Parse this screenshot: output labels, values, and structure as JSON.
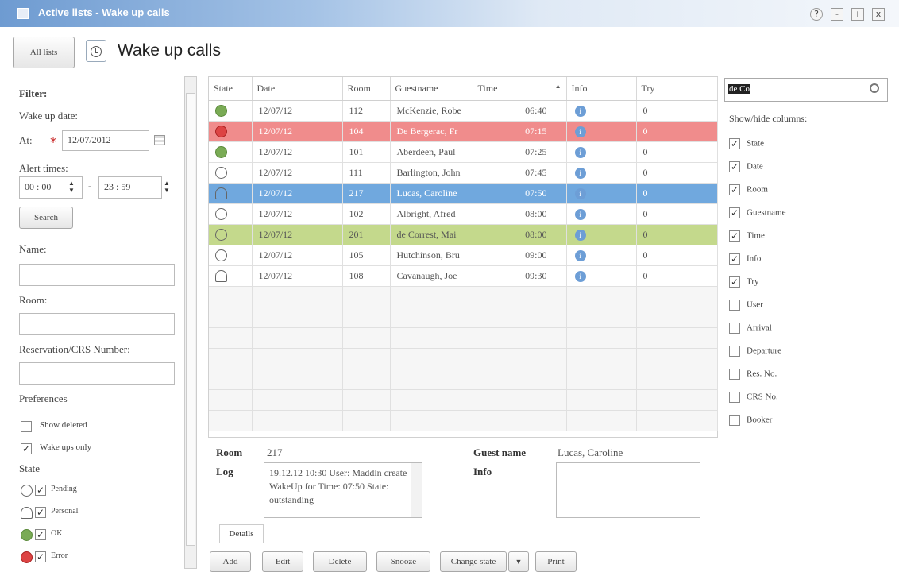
{
  "window": {
    "title": "Active lists - Wake up calls",
    "help": "?",
    "minimize": "-",
    "maximize": "+",
    "close": "x"
  },
  "header": {
    "all_lists": "All lists",
    "page_title": "Wake up calls"
  },
  "filter": {
    "title": "Filter:",
    "wake_up_date": "Wake up date:",
    "at": "At:",
    "date_value": "12/07/2012",
    "alert_times": "Alert times:",
    "from_time": "00 : 00",
    "dash": "-",
    "to_time": "23 : 59",
    "search": "Search",
    "name": "Name:",
    "room": "Room:",
    "reservation": "Reservation/CRS Number:",
    "preferences": "Preferences",
    "show_deleted": "Show deleted",
    "wake_ups_only": "Wake ups only",
    "state": "State",
    "states": [
      "Pending",
      "Personal",
      "OK",
      "Error"
    ]
  },
  "grid": {
    "columns": [
      "State",
      "Date",
      "Room",
      "Guestname",
      "Time",
      "Info",
      "Try"
    ],
    "sort_indicator": "▲",
    "rows": [
      {
        "state": "ok",
        "date": "12/07/12",
        "room": "112",
        "guest": "McKenzie, Robe",
        "time": "06:40",
        "try": "0",
        "style": ""
      },
      {
        "state": "err",
        "date": "12/07/12",
        "room": "104",
        "guest": "De Bergerac, Fr",
        "time": "07:15",
        "try": "0",
        "style": "row-red"
      },
      {
        "state": "ok",
        "date": "12/07/12",
        "room": "101",
        "guest": "Aberdeen, Paul",
        "time": "07:25",
        "try": "0",
        "style": ""
      },
      {
        "state": "pending",
        "date": "12/07/12",
        "room": "111",
        "guest": "Barlington, John",
        "time": "07:45",
        "try": "0",
        "style": ""
      },
      {
        "state": "personal",
        "date": "12/07/12",
        "room": "217",
        "guest": "Lucas, Caroline",
        "time": "07:50",
        "try": "0",
        "style": "row-blue"
      },
      {
        "state": "pending",
        "date": "12/07/12",
        "room": "102",
        "guest": "Albright, Afred",
        "time": "08:00",
        "try": "0",
        "style": ""
      },
      {
        "state": "pending",
        "date": "12/07/12",
        "room": "201",
        "guest": "de Correst, Mai",
        "time": "08:00",
        "try": "0",
        "style": "row-green"
      },
      {
        "state": "pending",
        "date": "12/07/12",
        "room": "105",
        "guest": "Hutchinson, Bru",
        "time": "09:00",
        "try": "0",
        "style": ""
      },
      {
        "state": "personal",
        "date": "12/07/12",
        "room": "108",
        "guest": "Cavanaugh, Joe",
        "time": "09:30",
        "try": "0",
        "style": ""
      }
    ]
  },
  "details": {
    "room_label": "Room",
    "room_value": "217",
    "guest_label": "Guest name",
    "guest_value": "Lucas, Caroline",
    "log_label": "Log",
    "log_text": "19.12.12 10:30 User: Maddin create WakeUp for Time: 07:50 State: outstanding",
    "info_label": "Info",
    "tab": "Details"
  },
  "actions": [
    "Add",
    "Edit",
    "Delete",
    "Snooze",
    "Change state",
    "Print"
  ],
  "columns_panel": {
    "search_value": "de Co",
    "title": "Show/hide columns:",
    "items": [
      {
        "label": "State",
        "checked": true
      },
      {
        "label": "Date",
        "checked": true
      },
      {
        "label": "Room",
        "checked": true
      },
      {
        "label": "Guestname",
        "checked": true
      },
      {
        "label": "Time",
        "checked": true
      },
      {
        "label": "Info",
        "checked": true
      },
      {
        "label": "Try",
        "checked": true
      },
      {
        "label": "User",
        "checked": false
      },
      {
        "label": "Arrival",
        "checked": false
      },
      {
        "label": "Departure",
        "checked": false
      },
      {
        "label": "Res. No.",
        "checked": false
      },
      {
        "label": "CRS No.",
        "checked": false
      },
      {
        "label": "Booker",
        "checked": false
      }
    ]
  },
  "colors": {
    "error_row": "#f08c8c",
    "selected_row": "#70a8de",
    "highlight_row": "#c4d98c",
    "titlebar": "#6e9bd1"
  }
}
